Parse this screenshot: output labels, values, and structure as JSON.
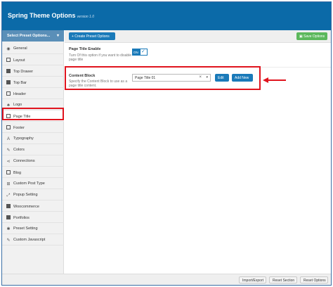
{
  "header": {
    "title": "Spring Theme Options",
    "version": "version 1.0"
  },
  "sidebar": {
    "preset_select_label": "Select Preset Options...",
    "items": [
      {
        "label": "General",
        "icon": "globe-icon"
      },
      {
        "label": "Layout",
        "icon": "layout-icon"
      },
      {
        "label": "Top Drawer",
        "icon": "top-drawer-icon"
      },
      {
        "label": "Top Bar",
        "icon": "top-bar-icon"
      },
      {
        "label": "Header",
        "icon": "header-icon"
      },
      {
        "label": "Logo",
        "icon": "logo-icon"
      },
      {
        "label": "Page Title",
        "icon": "page-title-icon"
      },
      {
        "label": "Footer",
        "icon": "footer-icon"
      },
      {
        "label": "Typography",
        "icon": "typography-icon"
      },
      {
        "label": "Colors",
        "icon": "brush-icon"
      },
      {
        "label": "Connections",
        "icon": "share-icon"
      },
      {
        "label": "Blog",
        "icon": "blog-icon"
      },
      {
        "label": "Custom Post Type",
        "icon": "grid-icon"
      },
      {
        "label": "Popup Setting",
        "icon": "expand-icon"
      },
      {
        "label": "Woocommerce",
        "icon": "woocommerce-icon"
      },
      {
        "label": "Portfolios",
        "icon": "folder-icon"
      },
      {
        "label": "Preset Setting",
        "icon": "gear-icon"
      },
      {
        "label": "Custom Javascript",
        "icon": "code-icon"
      }
    ],
    "active_item": "Page Title"
  },
  "toolbar": {
    "create_preset_label": "+ Create Preset Options",
    "save_label": "Save Options"
  },
  "options": {
    "page_title_enable": {
      "title": "Page Title Enable",
      "description": "Turn Of this option if you want to disable page title",
      "toggle_label": "ON",
      "value": true
    },
    "content_block": {
      "title": "Content Block",
      "description": "Specify the Content Block to use as a page title content.",
      "selected": "Page Title 01",
      "edit_label": "Edit",
      "add_new_label": "Add New"
    }
  },
  "footer": {
    "import_export_label": "Import/Export",
    "reset_section_label": "Reset Section",
    "reset_options_label": "Reset Options"
  },
  "colors": {
    "header_bg": "#0b6aa8",
    "accent": "#1a7ab9",
    "save_green": "#5cb85c",
    "highlight_red": "#e0141e"
  }
}
